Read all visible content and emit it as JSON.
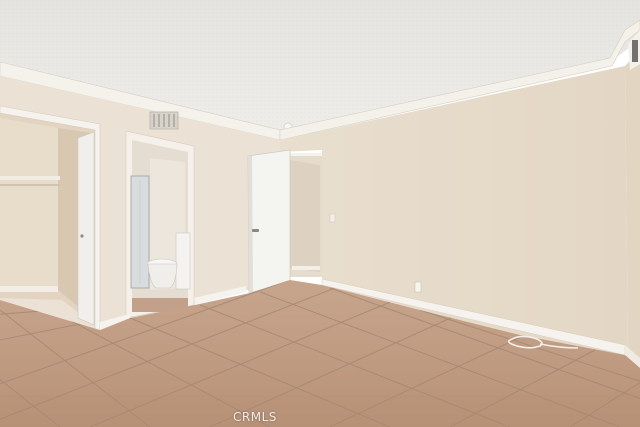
{
  "watermark": {
    "text": "CRMLS"
  },
  "colors": {
    "ceiling": "#e9e8e4",
    "wall_left": "#ebe2d6",
    "wall_right": "#e8dccb",
    "floor": "#c9a48a",
    "grout": "#a88772",
    "trim": "#f6f3ee",
    "door": "#f4f4f2",
    "vent": "#cfcbc4"
  }
}
